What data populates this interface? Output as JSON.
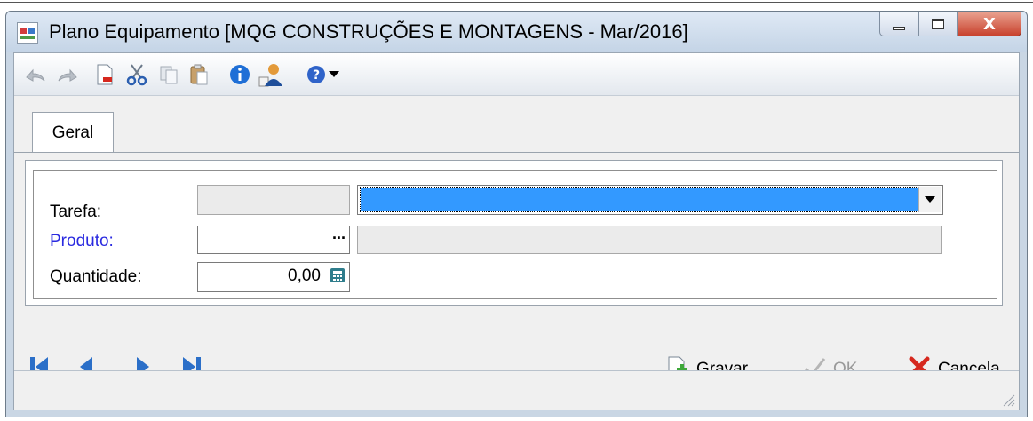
{
  "window": {
    "title": "Plano Equipamento [MQG CONSTRUÇÕES E MONTAGENS - Mar/2016]",
    "close_label": "X"
  },
  "toolbar": {
    "icons": [
      "undo-icon",
      "redo-icon",
      "delete-document-icon",
      "cut-icon",
      "copy-icon",
      "paste-icon",
      "info-icon",
      "user-icon",
      "help-icon",
      "dropdown-arrow-icon"
    ]
  },
  "tabs": [
    {
      "label_pre": "G",
      "label_u": "e",
      "label_post": "ral"
    }
  ],
  "form": {
    "tarefa_label": "Tarefa:",
    "produto_label": "Produto:",
    "produto_button": "...",
    "quantidade_label": "Quantidade:",
    "quantidade_value": "0,00"
  },
  "actions": {
    "gravar": {
      "u": "G",
      "rest": "ravar"
    },
    "ok": {
      "u": "O",
      "rest": "K"
    },
    "cancela": {
      "u": "C",
      "rest": "ancela"
    }
  },
  "colors": {
    "selection": "#3399ff",
    "nav_blue": "#2b6fc8",
    "link_blue": "#2a2ae0",
    "cancel_red": "#d6281e"
  }
}
